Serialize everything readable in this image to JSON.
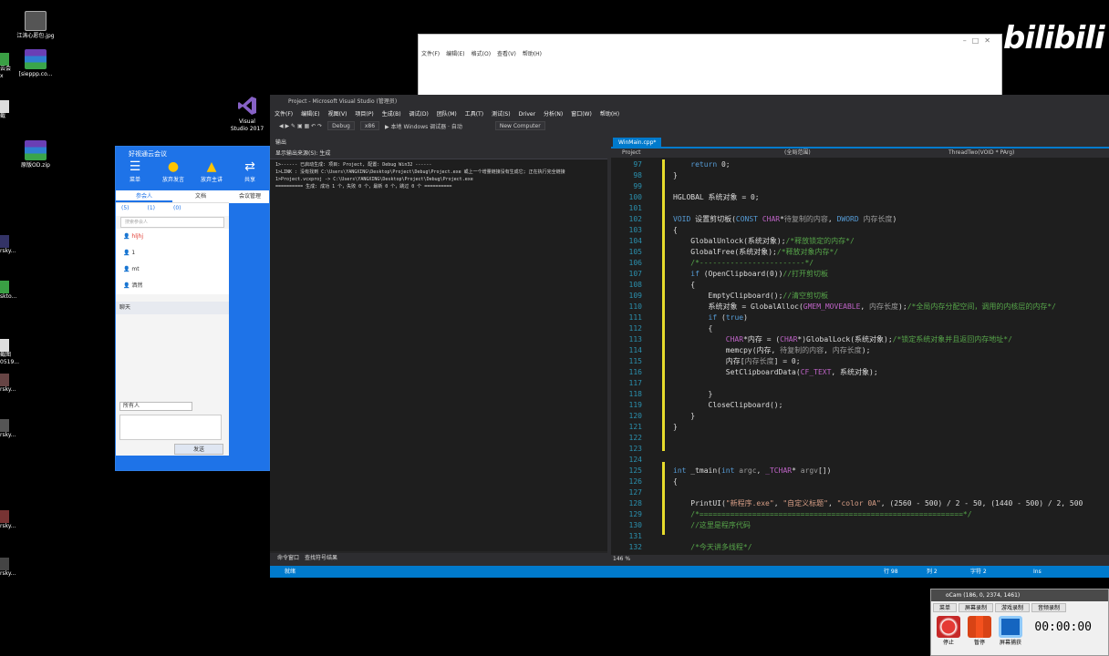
{
  "desktop": {
    "icons": [
      {
        "label": "江涛心愿包.jpg"
      },
      {
        "label": "[sieppp.co..."
      },
      {
        "label": "原版OD.zip"
      }
    ],
    "partial_labels": [
      "云会",
      "x",
      "截",
      "rsky...",
      "sktо...",
      "截图",
      "0519...",
      "rsky...",
      "rsky...",
      "rsky...",
      "rsky..."
    ]
  },
  "notepad": {
    "menu": [
      "文件(F)",
      "编辑(E)",
      "格式(O)",
      "查看(V)",
      "帮助(H)"
    ]
  },
  "watermark": "bilibili",
  "vs_icon": {
    "line1": "Visual",
    "line2": "Studio 2017"
  },
  "meeting": {
    "title": "好视通云会议",
    "tools": [
      "菜单",
      "放弃发言",
      "放弃主讲",
      "共享"
    ],
    "tabs": [
      "参会人",
      "文档",
      "会议管理"
    ],
    "counts": [
      "(5)",
      "(1)",
      "(0)"
    ],
    "search_placeholder": "搜索参会人",
    "users": [
      "hljhj",
      "1",
      "mt",
      "洒然"
    ],
    "chat_label": "聊天",
    "send_to": "所有人",
    "send_button": "发送"
  },
  "vs": {
    "title": "Project - Microsoft Visual Studio (管理员)",
    "menu": [
      "文件(F)",
      "编辑(E)",
      "视图(V)",
      "项目(P)",
      "生成(B)",
      "调试(D)",
      "团队(M)",
      "工具(T)",
      "测试(S)",
      "Driver",
      "分析(N)",
      "窗口(W)",
      "帮助(H)"
    ],
    "toolbar": {
      "config": "Debug",
      "platform": "x86",
      "run": "▶ 本地 Windows 调试器 · 自动",
      "target": "New Computer"
    },
    "output": {
      "title": "输出",
      "from": "显示输出来源(S): 生成",
      "lines": [
        "1>------ 已启动生成: 项目: Project, 配置: Debug Win32 ------",
        "1>LINK : 没有找到 C:\\Users\\YANGXING\\Desktop\\Project\\Debug\\Project.exe 或上一个增量链接没有生成它; 正在执行完全链接",
        "1>Project.vcxproj -> C:\\Users\\YANGXING\\Desktop\\Project\\Debug\\Project.exe",
        "========== 生成: 成功 1 个，失败 0 个，最新 0 个，跳过 0 个 =========="
      ],
      "tabs": [
        "命令窗口",
        "查找符号结果"
      ]
    },
    "editor": {
      "tab": "WinMain.cpp*",
      "nav_project": "Project",
      "nav_scope": "(全局范围)",
      "nav_func": "ThreadTwo(VOID * PArg)",
      "zoom": "146 %",
      "line_numbers": [
        "97",
        "98",
        "99",
        "100",
        "101",
        "102",
        "103",
        "104",
        "105",
        "106",
        "107",
        "108",
        "109",
        "110",
        "111",
        "112",
        "113",
        "114",
        "115",
        "116",
        "117",
        "118",
        "119",
        "120",
        "121",
        "122",
        "123",
        "124",
        "125",
        "126",
        "127",
        "128",
        "129",
        "130",
        "131",
        "132"
      ]
    },
    "status": {
      "ready": "就绪",
      "line": "行 98",
      "col": "列 2",
      "char": "字符 2",
      "ins": "Ins"
    }
  },
  "ocam": {
    "title": "oCam (186, 0, 2374, 1461)",
    "tabs": [
      "菜单",
      "屏幕录制",
      "游戏录制",
      "音频录制"
    ],
    "buttons": [
      "停止",
      "暂停",
      "屏幕捕获"
    ],
    "timer": "00:00:00"
  }
}
